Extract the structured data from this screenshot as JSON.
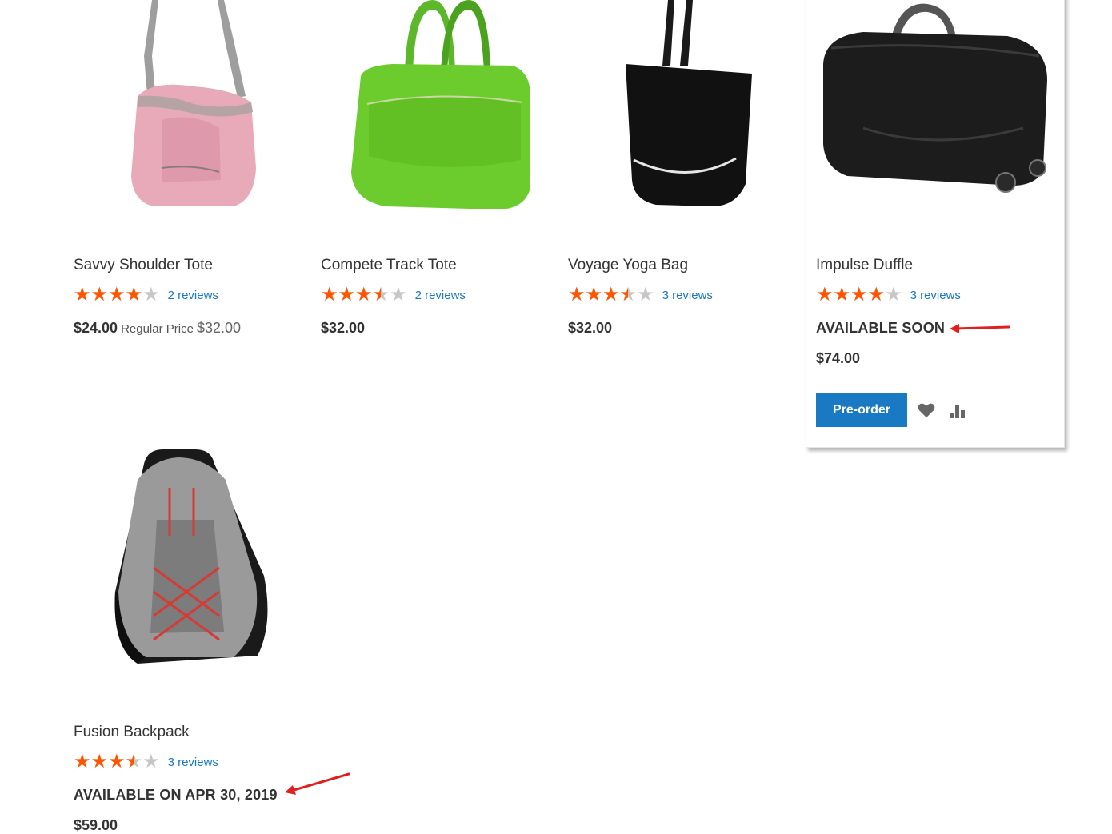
{
  "products": [
    {
      "name": "Savvy Shoulder Tote",
      "rating_percent": 80,
      "reviews": "2 reviews",
      "price": "$24.00",
      "regular_label": "Regular Price",
      "regular_value": "$32.00"
    },
    {
      "name": "Compete Track Tote",
      "rating_percent": 70,
      "reviews": "2 reviews",
      "price": "$32.00"
    },
    {
      "name": "Voyage Yoga Bag",
      "rating_percent": 70,
      "reviews": "3 reviews",
      "price": "$32.00"
    },
    {
      "name": "Impulse Duffle",
      "rating_percent": 80,
      "reviews": "3 reviews",
      "availability": "AVAILABLE SOON",
      "price": "$74.00",
      "action_label": "Pre-order"
    },
    {
      "name": "Fusion Backpack",
      "rating_percent": 70,
      "reviews": "3 reviews",
      "availability": "AVAILABLE ON APR 30, 2019",
      "price": "$59.00"
    }
  ],
  "icons": {
    "wishlist": "heart-icon",
    "compare": "bar-chart-icon"
  },
  "colors": {
    "star": "#ff5501",
    "link": "#1979c3",
    "button": "#1979c3",
    "annotation": "#e02020"
  },
  "stars_glyphs": "★★★★★"
}
